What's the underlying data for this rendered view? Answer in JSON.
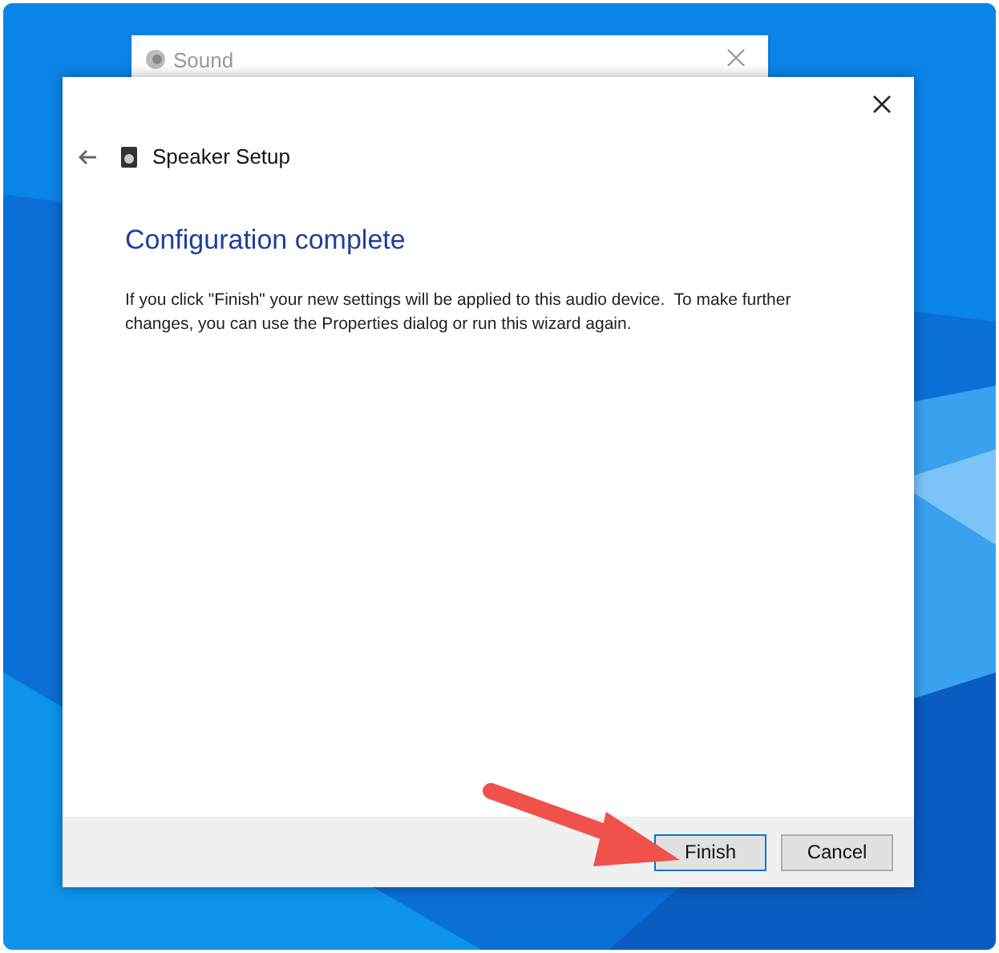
{
  "background_window": {
    "title": "Sound"
  },
  "dialog": {
    "wizard_title": "Speaker Setup",
    "heading": "Configuration complete",
    "body": "If you click \"Finish\" your new settings will be applied to this audio device.  To make further changes, you can use the Properties dialog or run this wizard again.",
    "buttons": [
      {
        "label": "Finish",
        "focused": true
      },
      {
        "label": "Cancel",
        "focused": false
      }
    ]
  }
}
